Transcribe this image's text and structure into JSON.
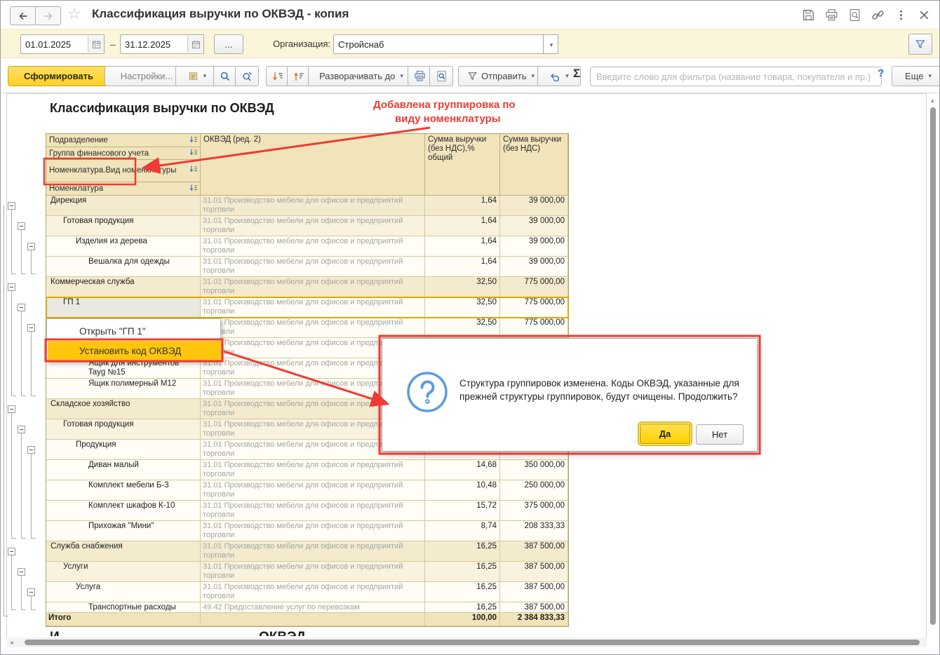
{
  "window": {
    "title": "Классификация выручки по ОКВЭД - копия"
  },
  "filterbar": {
    "date_from": "01.01.2025",
    "dash": "–",
    "date_to": "31.12.2025",
    "more": "...",
    "org_label": "Организация:",
    "org_value": "Стройснаб"
  },
  "toolbar": {
    "generate": "Сформировать",
    "settings": "Настройки...",
    "expand_to": "Разворачивать до",
    "send": "Отправить",
    "sigma": "Σ",
    "filter_placeholder": "Введите слово для фильтра (название товара, покупателя и пр.)",
    "help": "?",
    "more": "Еще"
  },
  "report": {
    "title": "Классификация выручки по ОКВЭД",
    "annotation": [
      "Добавлена группировка по",
      "виду номенклатуры"
    ],
    "partial_heading": {
      "left": "И",
      "right": "ОКВЭД"
    },
    "table": {
      "row_headers": [
        "Подразделение",
        "Группа финансового учета",
        "Номенклатура.Вид номенклатуры",
        "Номенклатура"
      ],
      "col_headers": [
        "ОКВЭД (ред. 2)",
        "Сумма выручки (без НДС),% общий",
        "Сумма выручки (без НДС)"
      ],
      "rows": [
        {
          "name": "Дирекция",
          "level": 0,
          "okved": "31.01 Производство мебели для офисов и предприятий торговли",
          "pct": "1,64",
          "sum": "39 000,00",
          "tone": "g0"
        },
        {
          "name": "Готовая продукция",
          "level": 1,
          "okved": "31.01 Производство мебели для офисов и предприятий торговли",
          "pct": "1,64",
          "sum": "39 000,00",
          "tone": "g1"
        },
        {
          "name": "Изделия из дерева",
          "level": 2,
          "okved": "31.01 Производство мебели для офисов и предприятий торговли",
          "pct": "1,64",
          "sum": "39 000,00",
          "tone": "w"
        },
        {
          "name": "Вешалка для одежды",
          "level": 3,
          "okved": "31.01 Производство мебели для офисов и предприятий торговли",
          "pct": "1,64",
          "sum": "39 000,00",
          "tone": "w"
        },
        {
          "name": "Коммерческая служба",
          "level": 0,
          "okved": "31.01 Производство мебели для офисов и предприятий торговли",
          "pct": "32,50",
          "sum": "775 000,00",
          "tone": "g0"
        },
        {
          "name": "ГП 1",
          "level": 1,
          "okved": "31.01 Производство мебели для офисов и предприятий торговли",
          "pct": "32,50",
          "sum": "775 000,00",
          "tone": "g1",
          "selected": true
        },
        {
          "name": "",
          "level": 2,
          "okved": "31.01 Производство мебели для офисов и предприятий торговли",
          "pct": "32,50",
          "sum": "775 000,00",
          "tone": "w"
        },
        {
          "name": "",
          "level": 3,
          "okved": "31.01 Производство мебели для офисов и предприятий торговли",
          "pct": "",
          "sum": "",
          "tone": "w"
        },
        {
          "name": "Ящик для инструментов Tayg №15",
          "level": 3,
          "okved": "31.01 Производство мебели для офисов и предприятий торговли",
          "pct": "",
          "sum": "",
          "tone": "w"
        },
        {
          "name": "Ящик полимерный М12",
          "level": 3,
          "okved": "31.01 Производство мебели для офисов и предприятий торговли",
          "pct": "",
          "sum": "",
          "tone": "w"
        },
        {
          "name": "Складское хозяйство",
          "level": 0,
          "okved": "31.01 Производство мебели для офисов и предприятий торговли",
          "pct": "",
          "sum": "",
          "tone": "g0"
        },
        {
          "name": "Готовая продукция",
          "level": 1,
          "okved": "31.01 Производство мебели для офисов и предприятий торговли",
          "pct": "",
          "sum": "",
          "tone": "g1"
        },
        {
          "name": "Продукция",
          "level": 2,
          "okved": "31.01 Производство мебели для офисов и предприятий торговли",
          "pct": "",
          "sum": "",
          "tone": "w"
        },
        {
          "name": "Диван малый",
          "level": 3,
          "okved": "31.01 Производство мебели для офисов и предприятий торговли",
          "pct": "14,68",
          "sum": "350 000,00",
          "tone": "w"
        },
        {
          "name": "Комплект мебели Б-3",
          "level": 3,
          "okved": "31.01 Производство мебели для офисов и предприятий торговли",
          "pct": "10,48",
          "sum": "250 000,00",
          "tone": "w"
        },
        {
          "name": "Комплект шкафов К-10",
          "level": 3,
          "okved": "31.01 Производство мебели для офисов и предприятий торговли",
          "pct": "15,72",
          "sum": "375 000,00",
          "tone": "w"
        },
        {
          "name": "Прихожая \"Мини\"",
          "level": 3,
          "okved": "31.01 Производство мебели для офисов и предприятий торговли",
          "pct": "8,74",
          "sum": "208 333,33",
          "tone": "w"
        },
        {
          "name": "Служба снабжения",
          "level": 0,
          "okved": "31.01 Производство мебели для офисов и предприятий торговли",
          "pct": "16,25",
          "sum": "387 500,00",
          "tone": "g0"
        },
        {
          "name": "Услуги",
          "level": 1,
          "okved": "31.01 Производство мебели для офисов и предприятий торговли",
          "pct": "16,25",
          "sum": "387 500,00",
          "tone": "g1"
        },
        {
          "name": "Услуга",
          "level": 2,
          "okved": "31.01 Производство мебели для офисов и предприятий торговли",
          "pct": "16,25",
          "sum": "387 500,00",
          "tone": "w"
        },
        {
          "name": "Транспортные расходы",
          "level": 3,
          "okved": "49.42 Предоставление услуг по перевозкам",
          "pct": "16,25",
          "sum": "387 500,00",
          "tone": "w",
          "single": true
        }
      ],
      "total": {
        "name": "Итого",
        "pct": "100,00",
        "sum": "2 384 833,33"
      }
    }
  },
  "context_menu": {
    "open": "Открыть \"ГП 1\"",
    "set_code": "Установить код ОКВЭД"
  },
  "dialog": {
    "message": "Структура группировок изменена. Коды ОКВЭД, указанные для прежней структуры группировок, будут очищены. Продолжить?",
    "yes": "Да",
    "no": "Нет"
  },
  "colors": {
    "annotation_red": "#ee3b33",
    "accent_gold": "#ffd337",
    "menu_highlight": "#ffc60d",
    "header_tan": "#f1e4bb",
    "selection_border": "#dfa700"
  }
}
